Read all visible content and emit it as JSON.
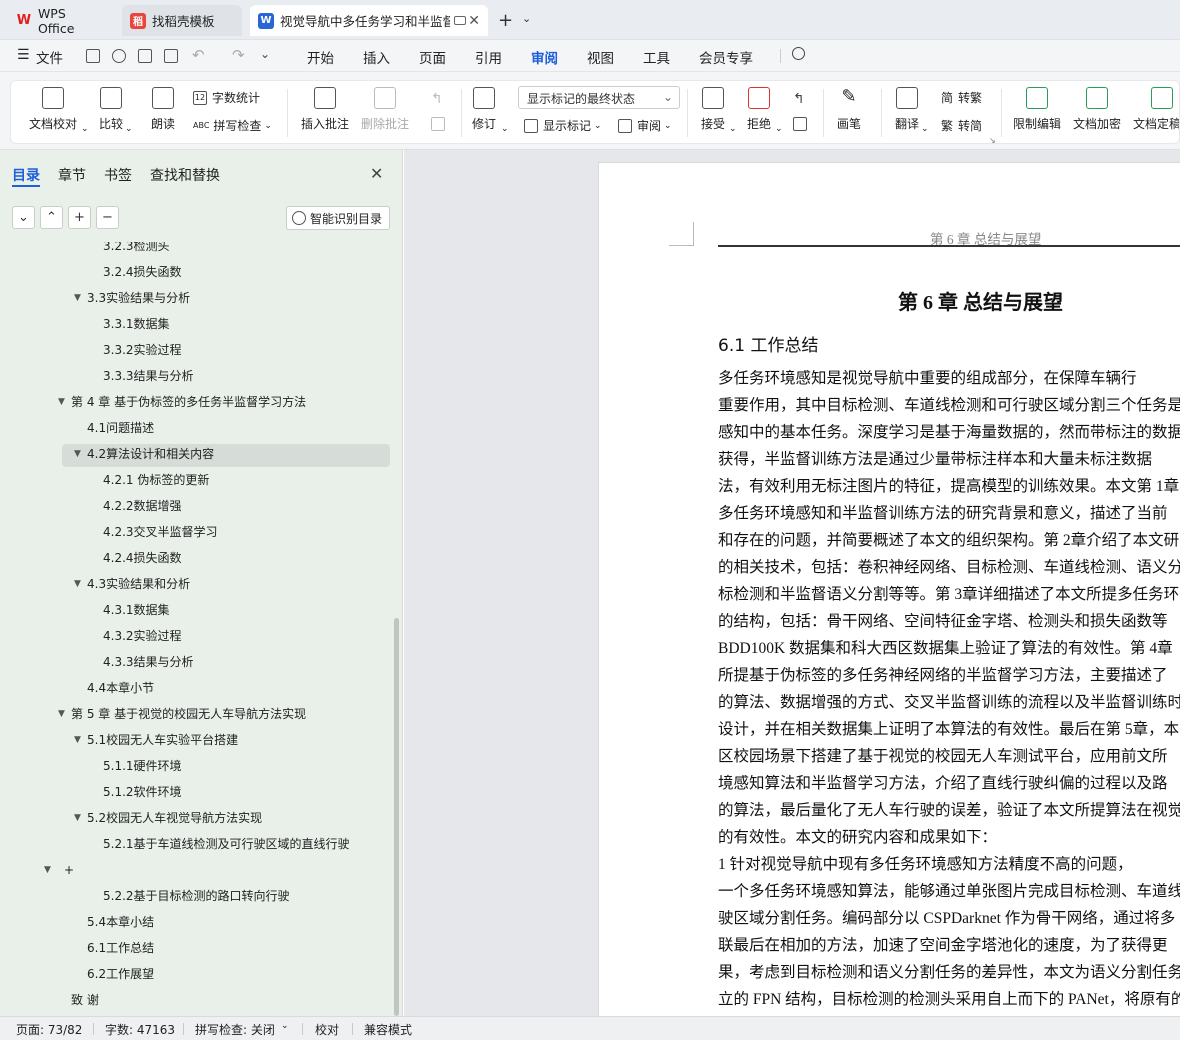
{
  "titlebar": {
    "tabs": [
      {
        "label": "WPS Office",
        "icon": "wps-logo-icon"
      },
      {
        "label": "找稻壳模板",
        "icon": "daoke-icon"
      },
      {
        "label": "视觉导航中多任务学习和半监督",
        "icon": "writer-w-icon"
      }
    ],
    "new_tab": "+",
    "new_tab_dropdown": "⌄"
  },
  "menubar": {
    "file": "文件",
    "tabs": [
      "开始",
      "插入",
      "页面",
      "引用",
      "审阅",
      "视图",
      "工具",
      "会员专享"
    ],
    "active_tab": "审阅"
  },
  "ribbon": {
    "doc_check": "文档校对",
    "compare": "比较",
    "read_aloud": "朗读",
    "word_count": "字数统计",
    "spell_check": "拼写检查",
    "insert_comment": "插入批注",
    "delete_comment": "删除批注",
    "revise": "修订",
    "markup_state": "显示标记的最终状态",
    "show_markup": "显示标记",
    "review_pane": "审阅",
    "accept": "接受",
    "reject": "拒绝",
    "pen": "画笔",
    "translate": "翻译",
    "to_traditional": "转繁",
    "to_simplified": "转简",
    "restrict_edit": "限制编辑",
    "doc_encrypt": "文档加密",
    "doc_finalize": "文档定稿",
    "abc": "ABC",
    "num": "12",
    "jian": "简",
    "fan": "繁"
  },
  "sidebar": {
    "tabs": [
      "目录",
      "章节",
      "书签",
      "查找和替换"
    ],
    "active_tab": "目录",
    "smart_toc": "智能识别目录",
    "toc": [
      {
        "label": "3.2.3检测头",
        "level": 3
      },
      {
        "label": "3.2.4损失函数",
        "level": 3
      },
      {
        "label": "3.3实验结果与分析",
        "level": 2,
        "arrow": "▼"
      },
      {
        "label": "3.3.1数据集",
        "level": 3
      },
      {
        "label": "3.3.2实验过程",
        "level": 3
      },
      {
        "label": "3.3.3结果与分析",
        "level": 3
      },
      {
        "label": "第 4 章  基于伪标签的多任务半监督学习方法",
        "level": 1,
        "arrow": "▼"
      },
      {
        "label": "4.1问题描述",
        "level": 2
      },
      {
        "label": "4.2算法设计和相关内容",
        "level": 2,
        "arrow": "▼",
        "selected": true
      },
      {
        "label": "4.2.1  伪标签的更新",
        "level": 3
      },
      {
        "label": "4.2.2数据增强",
        "level": 3
      },
      {
        "label": "4.2.3交叉半监督学习",
        "level": 3
      },
      {
        "label": "4.2.4损失函数",
        "level": 3
      },
      {
        "label": "4.3实验结果和分析",
        "level": 2,
        "arrow": "▼"
      },
      {
        "label": "4.3.1数据集",
        "level": 3
      },
      {
        "label": "4.3.2实验过程",
        "level": 3
      },
      {
        "label": "4.3.3结果与分析",
        "level": 3
      },
      {
        "label": "4.4本章小节",
        "level": 2
      },
      {
        "label": "第 5 章  基于视觉的校园无人车导航方法实现",
        "level": 1,
        "arrow": "▼"
      },
      {
        "label": "5.1校园无人车实验平台搭建",
        "level": 2,
        "arrow": "▼"
      },
      {
        "label": "5.1.1硬件环境",
        "level": 3
      },
      {
        "label": "5.1.2软件环境",
        "level": 3
      },
      {
        "label": "5.2校园无人车视觉导航方法实现",
        "level": 2,
        "arrow": "▼"
      },
      {
        "label": "5.2.1基于车道线检测及可行驶区域的直线行驶",
        "level": 3
      },
      {
        "label": "+",
        "level": 0,
        "arrow": "▼"
      },
      {
        "label": "5.2.2基于目标检测的路口转向行驶",
        "level": 3
      },
      {
        "label": "5.4本章小结",
        "level": 2
      },
      {
        "label": "6.1工作总结",
        "level": 2
      },
      {
        "label": "6.2工作展望",
        "level": 2
      },
      {
        "label": "致  谢",
        "level": 1
      }
    ]
  },
  "document": {
    "running_head": "第 6 章    总结与展望",
    "chapter_title": "第 6 章    总结与展望",
    "section_title": "6.1    工作总结",
    "lines": [
      "      多任务环境感知是视觉导航中重要的组成部分，在保障车辆行",
      "重要作用，其中目标检测、车道线检测和可行驶区域分割三个任务是",
      "感知中的基本任务。深度学习是基于海量数据的，然而带标注的数据",
      "获得，半监督训练方法是通过少量带标注样本和大量未标注数据",
      "法，有效利用无标注图片的特征，提高模型的训练效果。本文第 1章",
      "多任务环境感知和半监督训练方法的研究背景和意义，描述了当前",
      "和存在的问题，并简要概述了本文的组织架构。第 2章介绍了本文研",
      "的相关技术，包括：卷积神经网络、目标检测、车道线检测、语义分",
      "标检测和半监督语义分割等等。第 3章详细描述了本文所提多任务环",
      "的结构，包括：骨干网络、空间特征金字塔、检测头和损失函数等",
      "BDD100K 数据集和科大西区数据集上验证了算法的有效性。第 4章",
      "所提基于伪标签的多任务神经网络的半监督学习方法，主要描述了",
      "的算法、数据增强的方式、交叉半监督训练的流程以及半监督训练时",
      "设计，并在相关数据集上证明了本算法的有效性。最后在第 5章，本",
      "区校园场景下搭建了基于视觉的校园无人车测试平台，应用前文所",
      "境感知算法和半监督学习方法，介绍了直线行驶纠偏的过程以及路",
      "的算法，最后量化了无人车行驶的误差，验证了本文所提算法在视觉",
      "的有效性。本文的研究内容和成果如下：",
      "      1  针对视觉导航中现有多任务环境感知方法精度不高的问题，",
      "一个多任务环境感知算法，能够通过单张图片完成目标检测、车道线",
      "驶区域分割任务。编码部分以  CSPDarknet 作为骨干网络，通过将多",
      "联最后在相加的方法，加速了空间金字塔池化的速度，为了获得更",
      "果，考虑到目标检测和语义分割任务的差异性，本文为语义分割任务",
      "立的 FPN 结构，目标检测的检测头采用自上而下的  PANet，将原有的"
    ]
  },
  "statusbar": {
    "page": "页面: 73/82",
    "words": "字数: 47163",
    "spell": "拼写检查: 关闭",
    "proof": "校对",
    "compat": "兼容模式"
  }
}
